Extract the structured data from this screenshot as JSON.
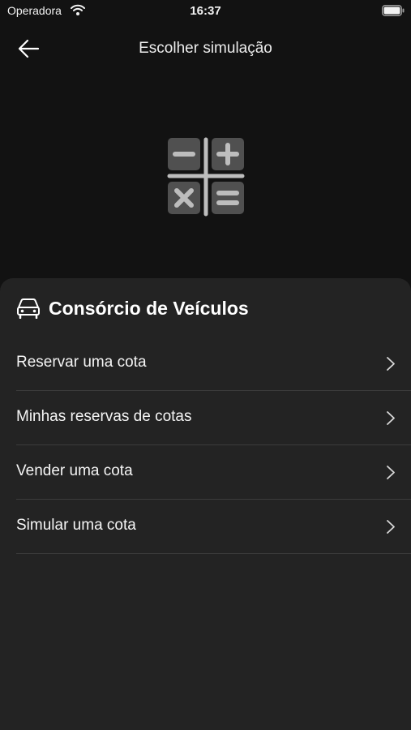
{
  "status_bar": {
    "carrier": "Operadora",
    "time": "16:37"
  },
  "nav": {
    "title": "Escolher simulação",
    "back_icon": "arrow-left-icon"
  },
  "hero": {
    "icon": "calculator-icon"
  },
  "section": {
    "icon": "car-icon",
    "title": "Consórcio de Veículos",
    "items": [
      {
        "label": "Reservar uma cota"
      },
      {
        "label": "Minhas reservas de cotas"
      },
      {
        "label": "Vender uma cota"
      },
      {
        "label": "Simular uma cota"
      }
    ]
  },
  "colors": {
    "background": "#121212",
    "sheet": "#232323",
    "divider": "#3c3c3c",
    "text": "#ffffff",
    "icon_tile": "#505050",
    "icon_stroke": "#bdbdbd"
  }
}
